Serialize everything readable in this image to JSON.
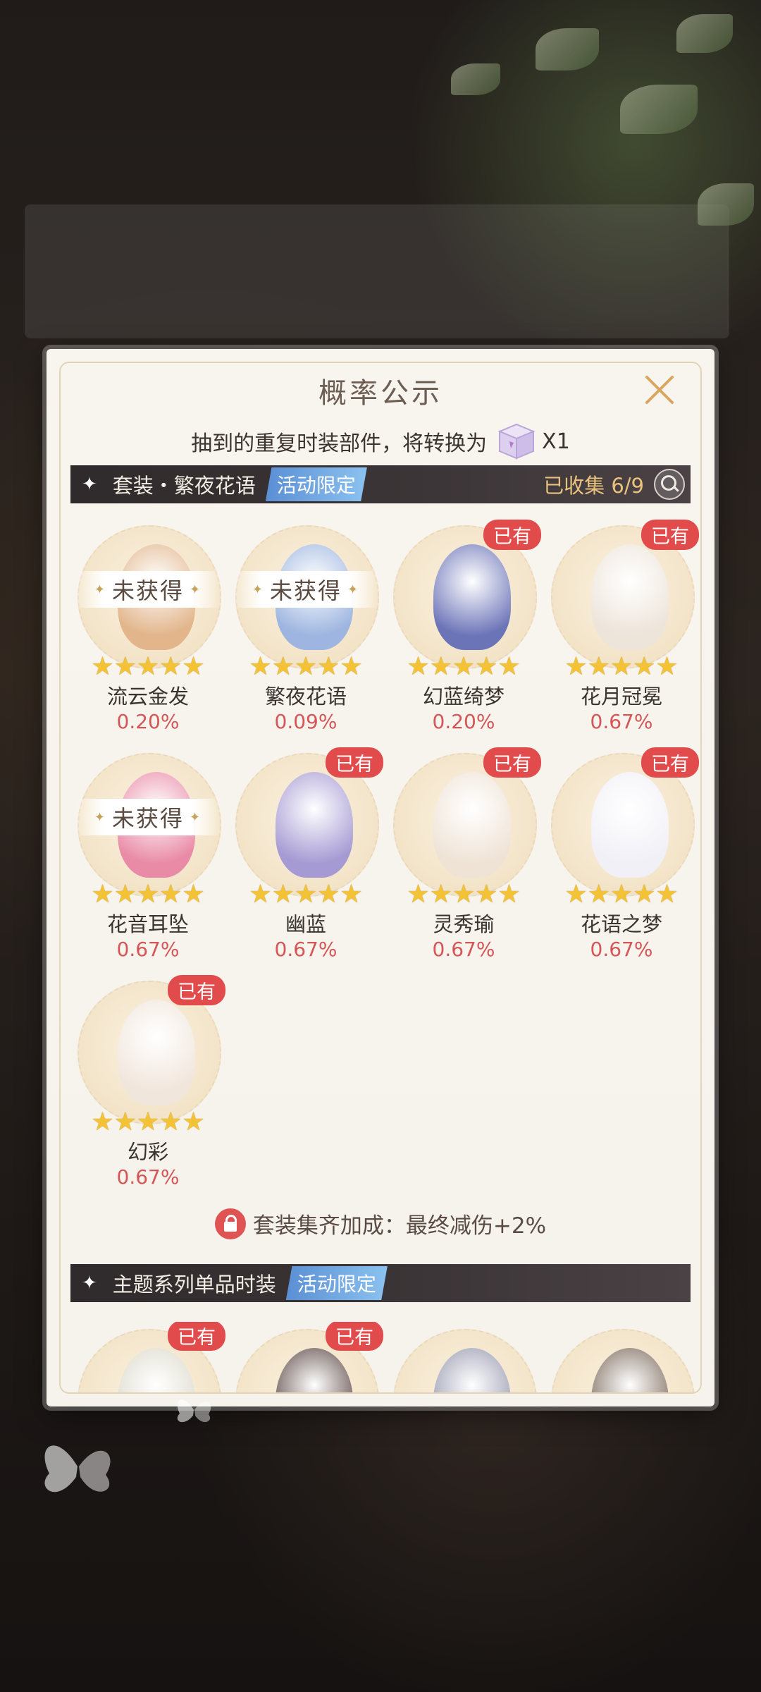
{
  "modal": {
    "title": "概率公示",
    "notice_text": "抽到的重复时装部件，将转换为",
    "notice_qty": "X1"
  },
  "suit_section": {
    "label": "套装・繁夜花语",
    "tag": "活动限定",
    "collected": "已收集 6/9"
  },
  "status": {
    "owned": "已有",
    "not_obtained": "未获得"
  },
  "items": [
    {
      "name": "流云金发",
      "rate": "0.20%",
      "owned": false,
      "stars": "★★★★★",
      "art_color": "#e2b58b"
    },
    {
      "name": "繁夜花语",
      "rate": "0.09%",
      "owned": false,
      "stars": "★★★★★",
      "art_color": "#9db5e0"
    },
    {
      "name": "幻蓝绮梦",
      "rate": "0.20%",
      "owned": true,
      "stars": "★★★★★",
      "art_color": "#6c74b8"
    },
    {
      "name": "花月冠冕",
      "rate": "0.67%",
      "owned": true,
      "stars": "★★★★★",
      "art_color": "#ede4da"
    },
    {
      "name": "花音耳坠",
      "rate": "0.67%",
      "owned": false,
      "stars": "★★★★★",
      "art_color": "#e98aa6"
    },
    {
      "name": "幽蓝",
      "rate": "0.67%",
      "owned": true,
      "stars": "★★★★★",
      "art_color": "#a59ad3"
    },
    {
      "name": "灵秀瑜",
      "rate": "0.67%",
      "owned": true,
      "stars": "★★★★★",
      "art_color": "#efe3d6"
    },
    {
      "name": "花语之梦",
      "rate": "0.67%",
      "owned": true,
      "stars": "★★★★★",
      "art_color": "#f1f0f6"
    },
    {
      "name": "幻彩",
      "rate": "0.67%",
      "owned": true,
      "stars": "★★★★★",
      "art_color": "#f1e6dc"
    }
  ],
  "bonus": {
    "text": "套装集齐加成：最终减伤+2%"
  },
  "theme_section": {
    "label": "主题系列单品时装",
    "tag": "活动限定"
  },
  "bottom_items": [
    {
      "owned": true,
      "art_color": "#d9d6c6"
    },
    {
      "owned": true,
      "art_color": "#4a3531"
    },
    {
      "owned": false,
      "art_color": "#8c8fa6"
    },
    {
      "owned": false,
      "art_color": "#6d5a4a"
    }
  ],
  "colors": {
    "owned_badge": "#e24b4b",
    "rate_text": "#d55656",
    "tag_blue": "#5b8fd4",
    "star_gold": "#f3c235"
  }
}
